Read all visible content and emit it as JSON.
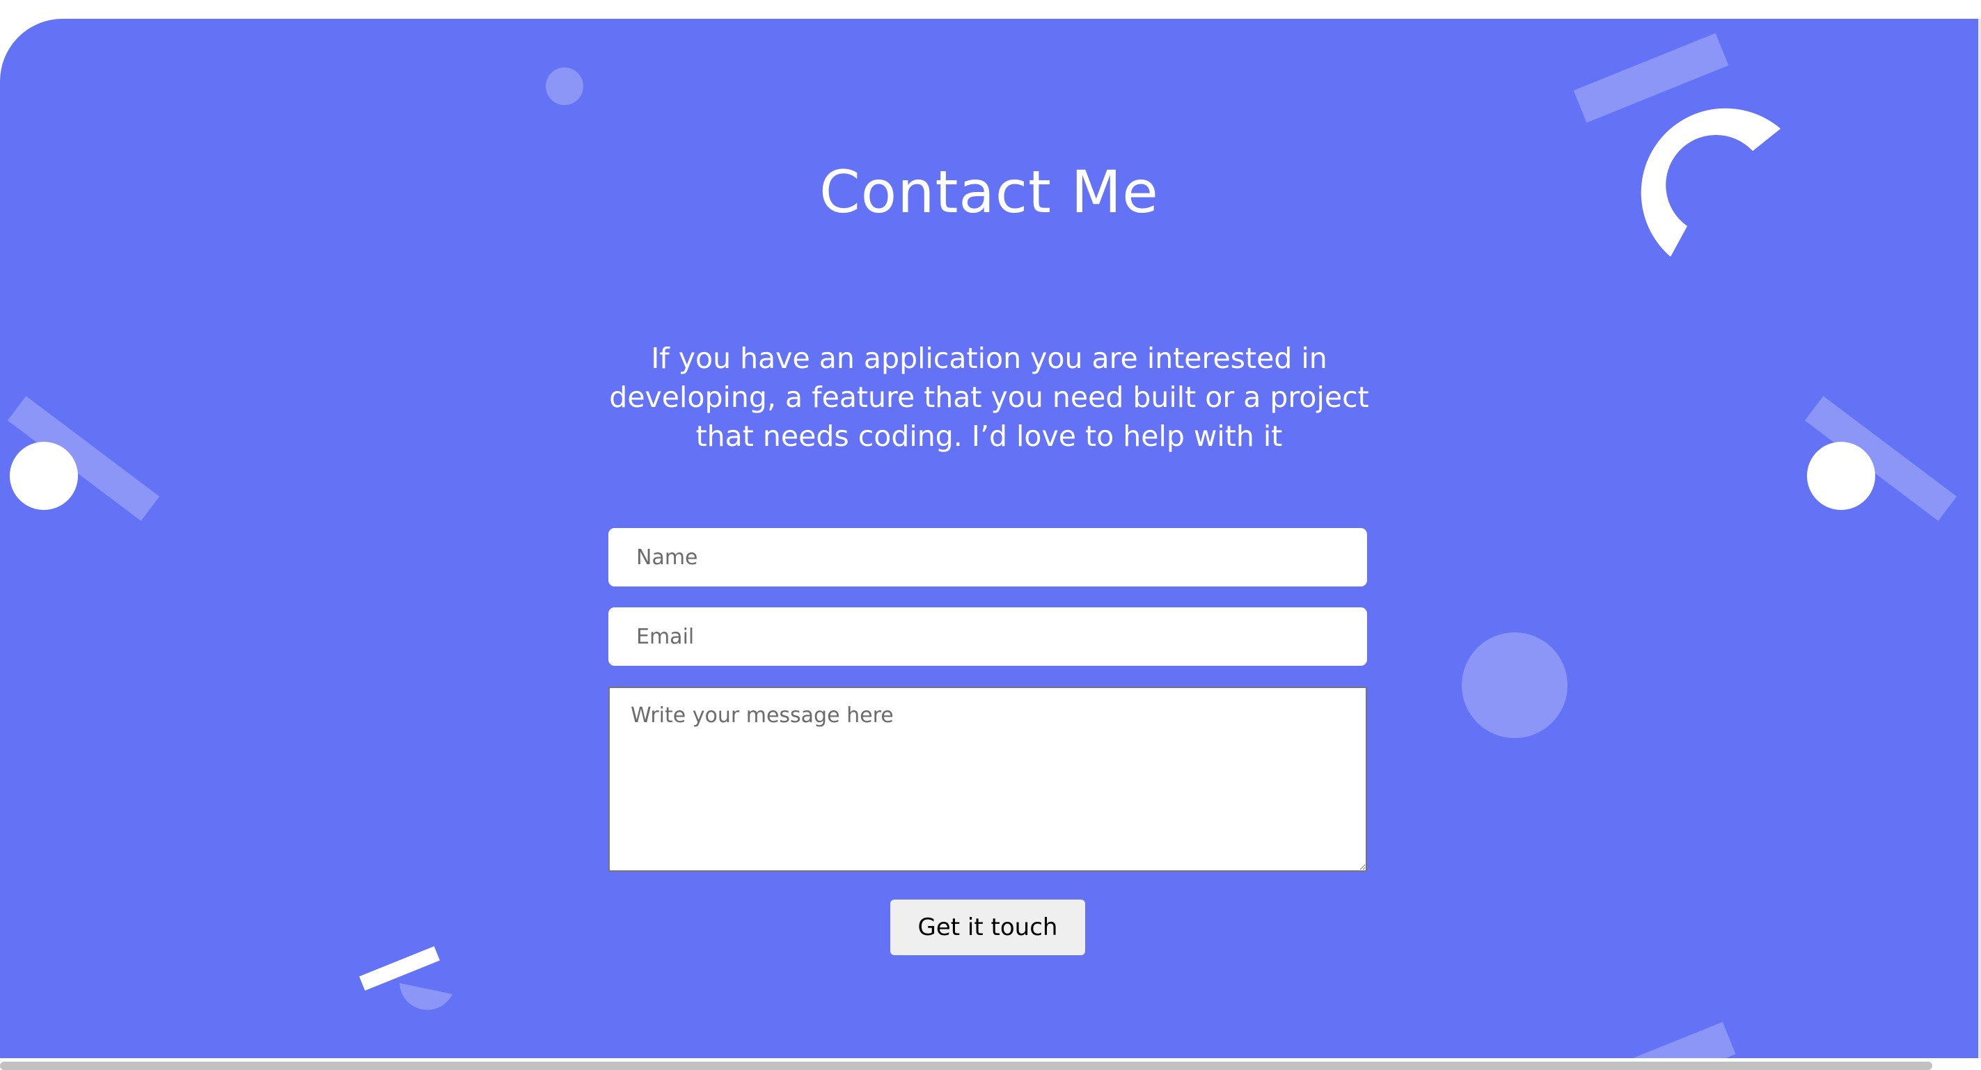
{
  "contact": {
    "title": "Contact Me",
    "intro": "If you have an application you are interested in developing, a feature that you need built or a project that needs coding. I’d love to help with it",
    "form": {
      "name_placeholder": "Name",
      "email_placeholder": "Email",
      "message_placeholder": "Write your message here",
      "submit_label": "Get it touch"
    }
  },
  "colors": {
    "background": "#6473f5",
    "text": "#ffffff",
    "button": "#efefef"
  }
}
